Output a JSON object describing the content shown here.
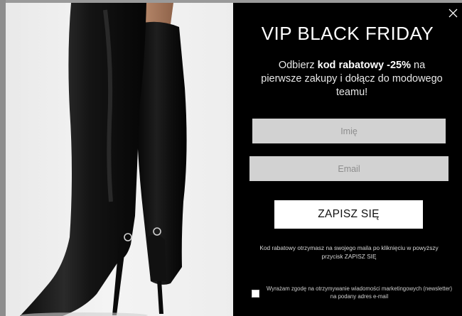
{
  "popup": {
    "title": "VIP BLACK FRIDAY",
    "subtitle_prefix": "Odbierz ",
    "subtitle_bold": "kod rabatowy -25%",
    "subtitle_suffix": " na pierwsze zakupy i dołącz do modowego teamu!",
    "name_placeholder": "Imię",
    "email_placeholder": "Email",
    "submit_label": "ZAPISZ SIĘ",
    "note": "Kod rabatowy otrzymasz na swojego maila po kliknięciu w powyższy przycisk ZAPISZ SIĘ",
    "consent_text": "Wyrażam zgodę na otrzymywanie wiadomości marketingowych (newsletter) na podany adres e-mail",
    "consent_checked": false
  },
  "image": {
    "subject": "black leather knee-high stiletto boots"
  },
  "icons": {
    "close": "close-icon"
  },
  "colors": {
    "panel_bg": "#000000",
    "input_bg": "#d2d2d2",
    "button_bg": "#ffffff"
  }
}
